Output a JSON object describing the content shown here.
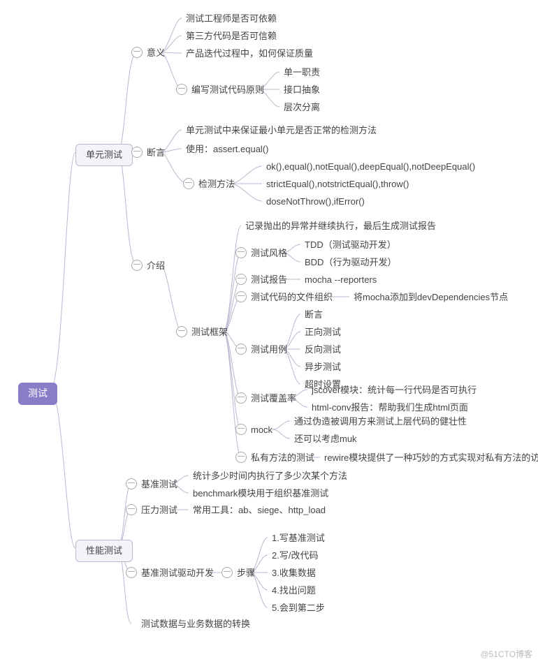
{
  "watermark": "@51CTO博客",
  "root": "测试",
  "nodes": {
    "unit": "单元测试",
    "perf": "性能测试",
    "meaning": "意义",
    "m1": "测试工程师是否可依赖",
    "m2": "第三方代码是否可信赖",
    "m3": "产品迭代过程中，如何保证质量",
    "principle": "编写测试代码原则",
    "p1": "单一职责",
    "p2": "接口抽象",
    "p3": "层次分离",
    "assert": "断言",
    "a1": "单元测试中来保证最小单元是否正常的检测方法",
    "a2": "使用：assert.equal()",
    "detect": "检测方法",
    "d1": "ok(),equal(),notEqual(),deepEqual(),notDeepEqual()",
    "d2": "strictEqual(),notstrictEqual(),throw()",
    "d3": "doseNotThrow(),ifError()",
    "intro": "介绍",
    "framework": "测试框架",
    "f1": "记录抛出的异常并继续执行，最后生成测试报告",
    "style": "测试风格",
    "s1": "TDD（测试驱动开发）",
    "s2": "BDD（行为驱动开发）",
    "report": "测试报告",
    "r1": "mocha  --reporters",
    "fileorg": "测试代码的文件组织",
    "fo1": "将mocha添加到devDependencies节点",
    "usecase": "测试用例",
    "u1": "断言",
    "u2": "正向测试",
    "u3": "反向测试",
    "u4": "异步测试",
    "u5": "超时设置",
    "coverage": "测试覆盖率",
    "c1": "jscover模块：统计每一行代码是否可执行",
    "c2": "html-conv报告：帮助我们生成html页面",
    "mock": "mock",
    "mk1": "通过伪造被调用方来测试上层代码的健壮性",
    "mk2": "还可以考虑muk",
    "private": "私有方法的测试",
    "pr1": "rewire模块提供了一种巧妙的方式实现对私有方法的访问",
    "bench": "基准测试",
    "b1": "统计多少时间内执行了多少次某个方法",
    "b2": "benchmark模块用于组织基准测试",
    "stress": "压力测试",
    "st1": "常用工具：ab、siege、http_load",
    "benchdrive": "基准测试驱动开发",
    "steps": "步骤",
    "sp1": "1.写基准测试",
    "sp2": "2.写/改代码",
    "sp3": "3.收集数据",
    "sp4": "4.找出问题",
    "sp5": "5.会到第二步",
    "convert": "测试数据与业务数据的转换"
  },
  "toggle_label": "—"
}
